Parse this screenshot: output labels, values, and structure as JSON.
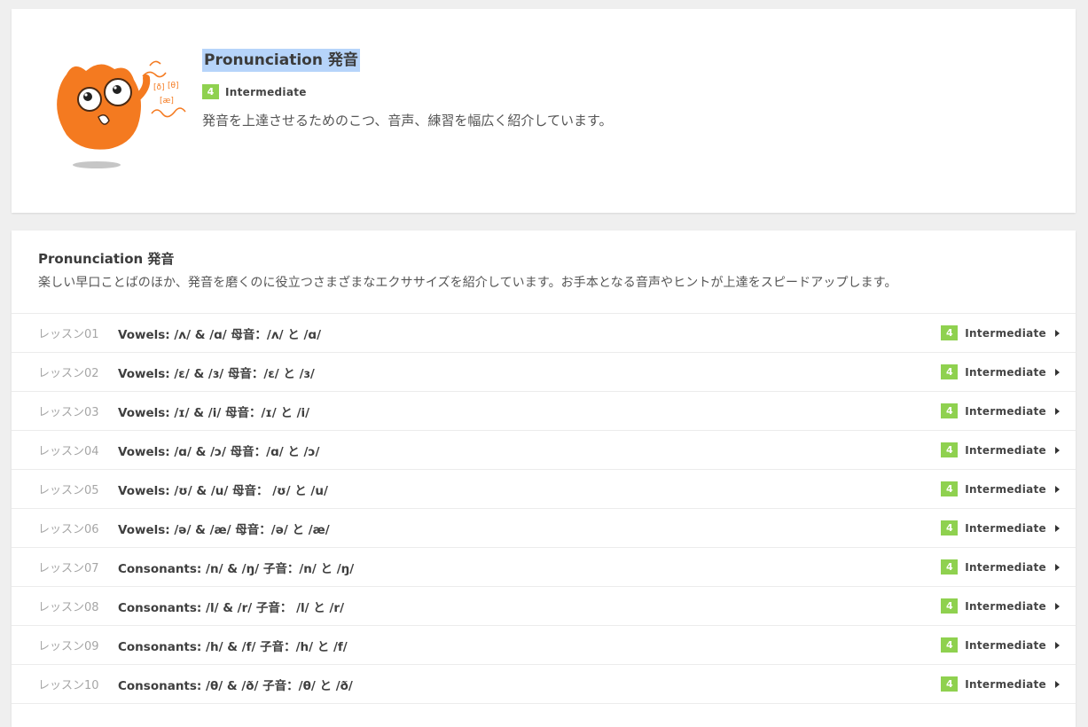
{
  "hero": {
    "title": "Pronunciation 発音",
    "level_num": "4",
    "level_label": "Intermediate",
    "description": "発音を上達させるためのこつ、音声、練習を幅広く紹介しています。",
    "mascot_symbols": [
      "[ð]",
      "[θ]",
      "[æ]"
    ]
  },
  "course": {
    "title": "Pronunciation 発音",
    "description": "楽しい早口ことばのほか、発音を磨くのに役立つさまざまなエクササイズを紹介しています。お手本となる音声やヒントが上達をスピードアップします。",
    "lessons": [
      {
        "num": "レッスン01",
        "title": "Vowels: /ʌ/ & /ɑ/ 母音：/ʌ/ と /ɑ/",
        "level_num": "4",
        "level_label": "Intermediate"
      },
      {
        "num": "レッスン02",
        "title": "Vowels: /ɛ/ & /ɜ/ 母音：/ɛ/ と /ɜ/",
        "level_num": "4",
        "level_label": "Intermediate"
      },
      {
        "num": "レッスン03",
        "title": "Vowels: /ɪ/ & /i/ 母音：/ɪ/ と /i/",
        "level_num": "4",
        "level_label": "Intermediate"
      },
      {
        "num": "レッスン04",
        "title": "Vowels: /ɑ/ & /ɔ/ 母音：/ɑ/ と /ɔ/",
        "level_num": "4",
        "level_label": "Intermediate"
      },
      {
        "num": "レッスン05",
        "title": "Vowels: /ʊ/ & /u/ 母音： /ʊ/ と /u/",
        "level_num": "4",
        "level_label": "Intermediate"
      },
      {
        "num": "レッスン06",
        "title": "Vowels: /ə/ & /æ/ 母音：/ə/ と /æ/",
        "level_num": "4",
        "level_label": "Intermediate"
      },
      {
        "num": "レッスン07",
        "title": "Consonants: /n/ & /ŋ/ 子音：/n/ と /ŋ/",
        "level_num": "4",
        "level_label": "Intermediate"
      },
      {
        "num": "レッスン08",
        "title": "Consonants: /l/ & /r/ 子音： /l/ と /r/",
        "level_num": "4",
        "level_label": "Intermediate"
      },
      {
        "num": "レッスン09",
        "title": "Consonants: /h/ & /f/ 子音：/h/ と /f/",
        "level_num": "4",
        "level_label": "Intermediate"
      },
      {
        "num": "レッスン10",
        "title": "Consonants: /θ/ & /ð/ 子音：/θ/ と /ð/",
        "level_num": "4",
        "level_label": "Intermediate"
      }
    ]
  },
  "colors": {
    "badge": "#8fd14f",
    "mascot": "#f47a20",
    "selection": "#b6d4fa",
    "background": "#efefef"
  }
}
